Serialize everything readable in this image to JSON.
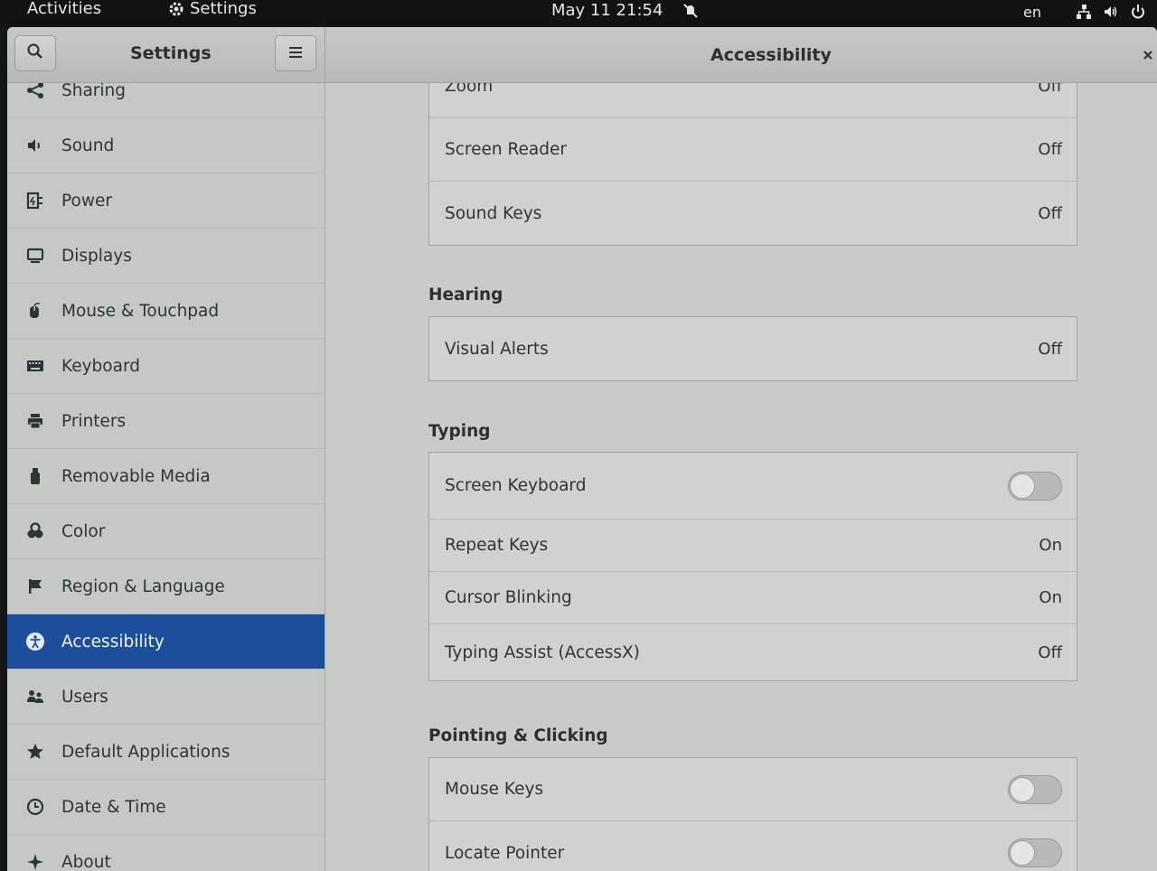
{
  "topbar": {
    "activities": "Activities",
    "app_menu": "Settings",
    "clock": "May 11  21:54",
    "lang": "en"
  },
  "header": {
    "sidebar_title": "Settings",
    "page_title": "Accessibility"
  },
  "sidebar": {
    "items": [
      {
        "label": "Sharing",
        "icon": "share-icon"
      },
      {
        "label": "Sound",
        "icon": "speaker-icon"
      },
      {
        "label": "Power",
        "icon": "power-plug-icon"
      },
      {
        "label": "Displays",
        "icon": "display-icon"
      },
      {
        "label": "Mouse & Touchpad",
        "icon": "mouse-icon"
      },
      {
        "label": "Keyboard",
        "icon": "keyboard-icon"
      },
      {
        "label": "Printers",
        "icon": "printer-icon"
      },
      {
        "label": "Removable Media",
        "icon": "usb-drive-icon"
      },
      {
        "label": "Color",
        "icon": "color-icon"
      },
      {
        "label": "Region & Language",
        "icon": "flag-icon"
      },
      {
        "label": "Accessibility",
        "icon": "accessibility-icon",
        "active": true
      },
      {
        "label": "Users",
        "icon": "users-icon"
      },
      {
        "label": "Default Applications",
        "icon": "star-icon"
      },
      {
        "label": "Date & Time",
        "icon": "clock-icon"
      },
      {
        "label": "About",
        "icon": "sparkle-icon"
      }
    ]
  },
  "seeing": {
    "rows": [
      {
        "name": "Zoom",
        "value": "Off"
      },
      {
        "name": "Screen Reader",
        "value": "Off"
      },
      {
        "name": "Sound Keys",
        "value": "Off"
      }
    ]
  },
  "hearing": {
    "heading": "Hearing",
    "rows": [
      {
        "name": "Visual Alerts",
        "value": "Off"
      }
    ]
  },
  "typing": {
    "heading": "Typing",
    "rows": [
      {
        "name": "Screen Keyboard",
        "toggle": false
      },
      {
        "name": "Repeat Keys",
        "value": "On"
      },
      {
        "name": "Cursor Blinking",
        "value": "On"
      },
      {
        "name": "Typing Assist (AccessX)",
        "value": "Off"
      }
    ]
  },
  "pointing": {
    "heading": "Pointing & Clicking",
    "rows": [
      {
        "name": "Mouse Keys",
        "toggle": false
      },
      {
        "name": "Locate Pointer",
        "toggle": false
      }
    ]
  },
  "colors": {
    "accent": "#1b4f9b",
    "topbar": "#121212"
  }
}
